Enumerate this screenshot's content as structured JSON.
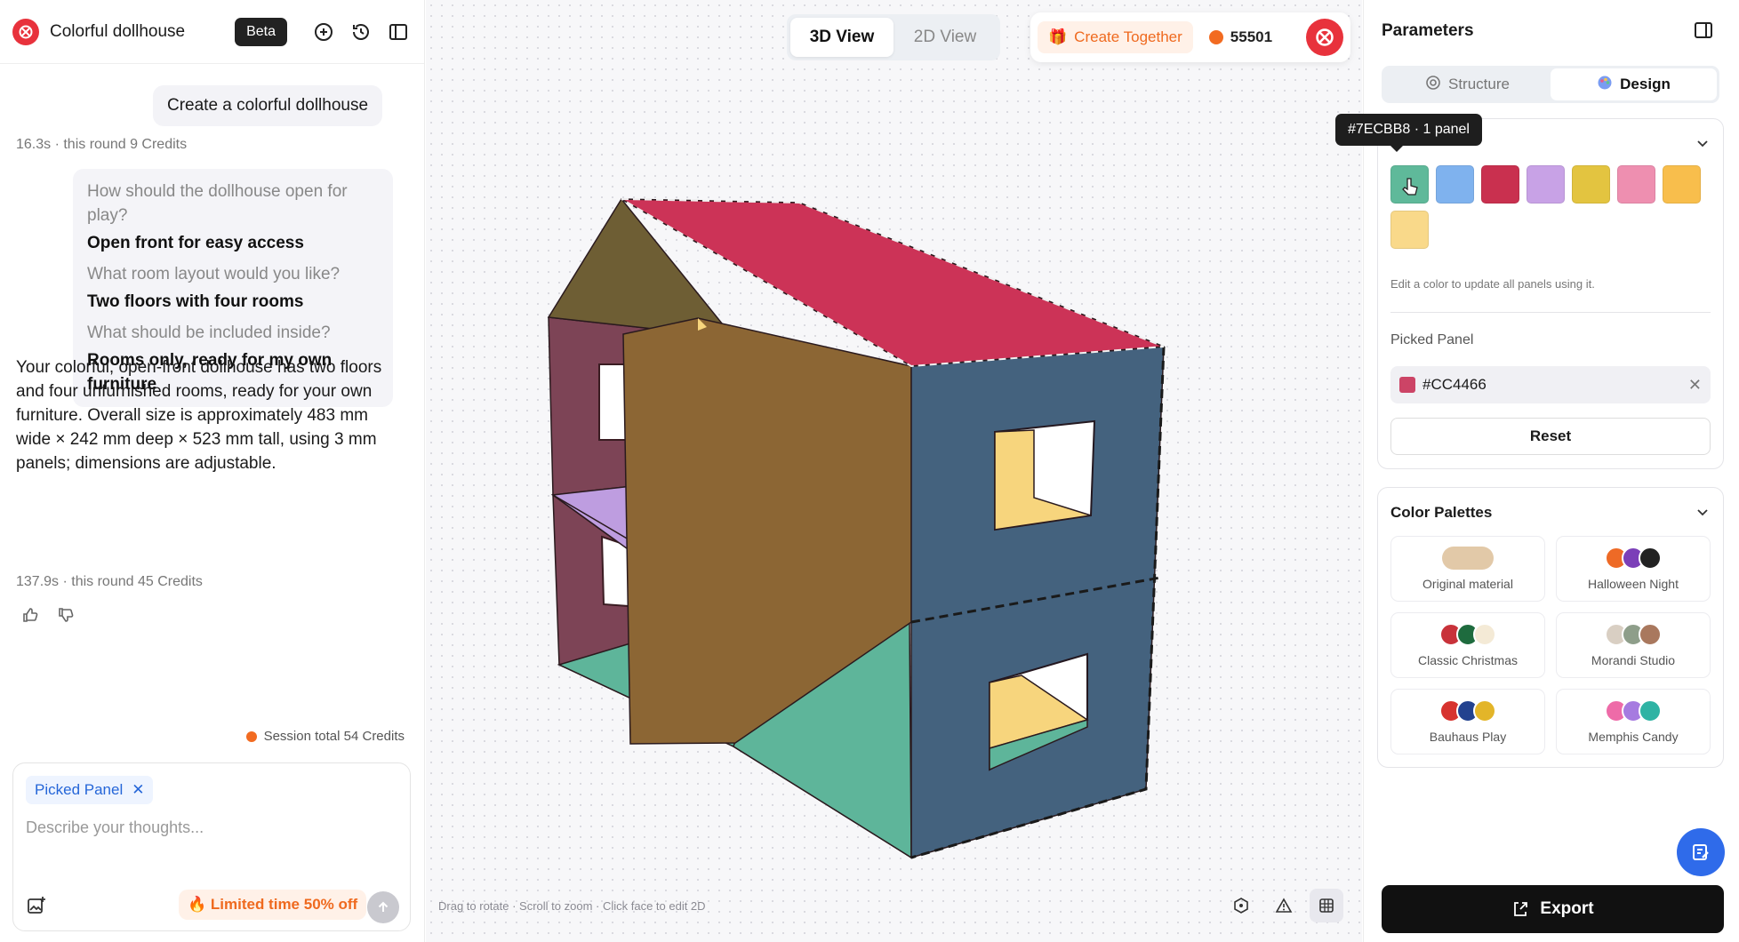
{
  "app": {
    "project_title": "Colorful dollhouse",
    "beta_label": "Beta"
  },
  "chat": {
    "user_message": "Create a colorful dollhouse",
    "round1_meta": "16.3s · this round 9 Credits",
    "qa": [
      {
        "q": "How should the dollhouse open for play?",
        "a": "Open front for easy access"
      },
      {
        "q": "What room layout would you like?",
        "a": "Two floors with four rooms"
      },
      {
        "q": "What should be included inside?",
        "a": "Rooms only, ready for my own furniture"
      }
    ],
    "answer": "Your colorful, open-front dollhouse has two floors and four unfurnished rooms, ready for your own furniture. Overall size is approximately 483 mm wide × 242 mm deep × 523 mm tall, using 3 mm panels; dimensions are adjustable.",
    "round2_meta": "137.9s · this round 45 Credits",
    "session_total": "Session total 54 Credits"
  },
  "composer": {
    "chip_label": "Picked Panel",
    "placeholder": "Describe your thoughts...",
    "promo": "Limited time 50% off"
  },
  "viewport": {
    "view_tabs": [
      "3D View",
      "2D View"
    ],
    "active_view": "3D View",
    "create_together": "Create Together",
    "credits": "55501",
    "hint": "Drag to rotate  ·  Scroll to zoom  ·  Click face to edit 2D"
  },
  "params": {
    "title": "Parameters",
    "tabs": [
      "Structure",
      "Design"
    ],
    "active_tab": "Design",
    "tooltip": "#7ECBB8 · 1 panel",
    "swatches": [
      "#5FB99A",
      "#7FB2EE",
      "#C9304F",
      "#C8A2E6",
      "#E3C440",
      "#EE8FB0",
      "#F8BE4C",
      "#F9D98A"
    ],
    "edit_hint": "Edit a color to update all panels using it.",
    "picked_label": "Picked Panel",
    "picked_value": "#CC4466",
    "picked_color": "#CC4466",
    "reset_label": "Reset",
    "palettes_title": "Color Palettes",
    "palettes": [
      {
        "name": "Original material",
        "colors": [
          "#E2C9A8"
        ]
      },
      {
        "name": "Halloween Night",
        "colors": [
          "#EE6A26",
          "#7B3FB8",
          "#222222"
        ]
      },
      {
        "name": "Classic Christmas",
        "colors": [
          "#C8323A",
          "#1E6B3E",
          "#F4EAD6"
        ]
      },
      {
        "name": "Morandi Studio",
        "colors": [
          "#D9CFC3",
          "#8E9E8A",
          "#A9785E"
        ]
      },
      {
        "name": "Bauhaus Play",
        "colors": [
          "#D7332F",
          "#23428F",
          "#E3B529"
        ]
      },
      {
        "name": "Memphis Candy",
        "colors": [
          "#EE6BA8",
          "#A67BE0",
          "#2FB3A4"
        ]
      }
    ],
    "export_label": "Export"
  },
  "house_colors": {
    "roof": "#CC3357",
    "right_wall": "#44627E",
    "left_wall": "#7D4456",
    "partition": "#8C6634",
    "gable": "#6E5E34",
    "floor_upper": "#BE9DE0",
    "floor_lower": "#5EB59A",
    "window_inner": "#F7D57D"
  }
}
